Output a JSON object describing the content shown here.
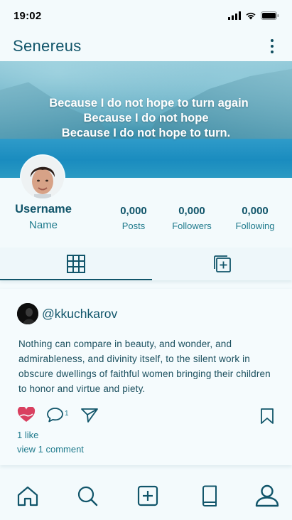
{
  "status_bar": {
    "time": "19:02",
    "icons": [
      "signal-icon",
      "wifi-icon",
      "battery-icon"
    ]
  },
  "app_bar": {
    "title": "Senereus",
    "menu_icon": "more-vertical-icon"
  },
  "cover": {
    "quote_lines": [
      "Because I do not hope to turn again",
      "Because I do not hope",
      "Because I do not hope to turn."
    ]
  },
  "profile": {
    "username": "Username",
    "name": "Name",
    "stats": [
      {
        "value": "0,000",
        "label": "Posts"
      },
      {
        "value": "0,000",
        "label": "Followers"
      },
      {
        "value": "0,000",
        "label": "Following"
      }
    ]
  },
  "tabs": [
    {
      "icon": "grid-icon",
      "active": true
    },
    {
      "icon": "tagged-posts-icon",
      "active": false
    }
  ],
  "post": {
    "author": "@kkuchkarov",
    "text": "Nothing can compare in beauty, and wonder, and admirableness, and divinity itself, to the silent work in obscure dwellings of faithful women bringing their children to honor and virtue and piety.",
    "comment_count": "1",
    "likes_text": "1 like",
    "view_comments_text": "view 1 comment"
  },
  "bottom_nav": [
    {
      "icon": "home-icon"
    },
    {
      "icon": "search-icon"
    },
    {
      "icon": "add-post-icon"
    },
    {
      "icon": "book-icon"
    },
    {
      "icon": "profile-icon",
      "active": true
    }
  ],
  "colors": {
    "primary": "#11556a",
    "accent": "#1f7a8c",
    "like": "#d94060",
    "background": "#f3fafc"
  }
}
